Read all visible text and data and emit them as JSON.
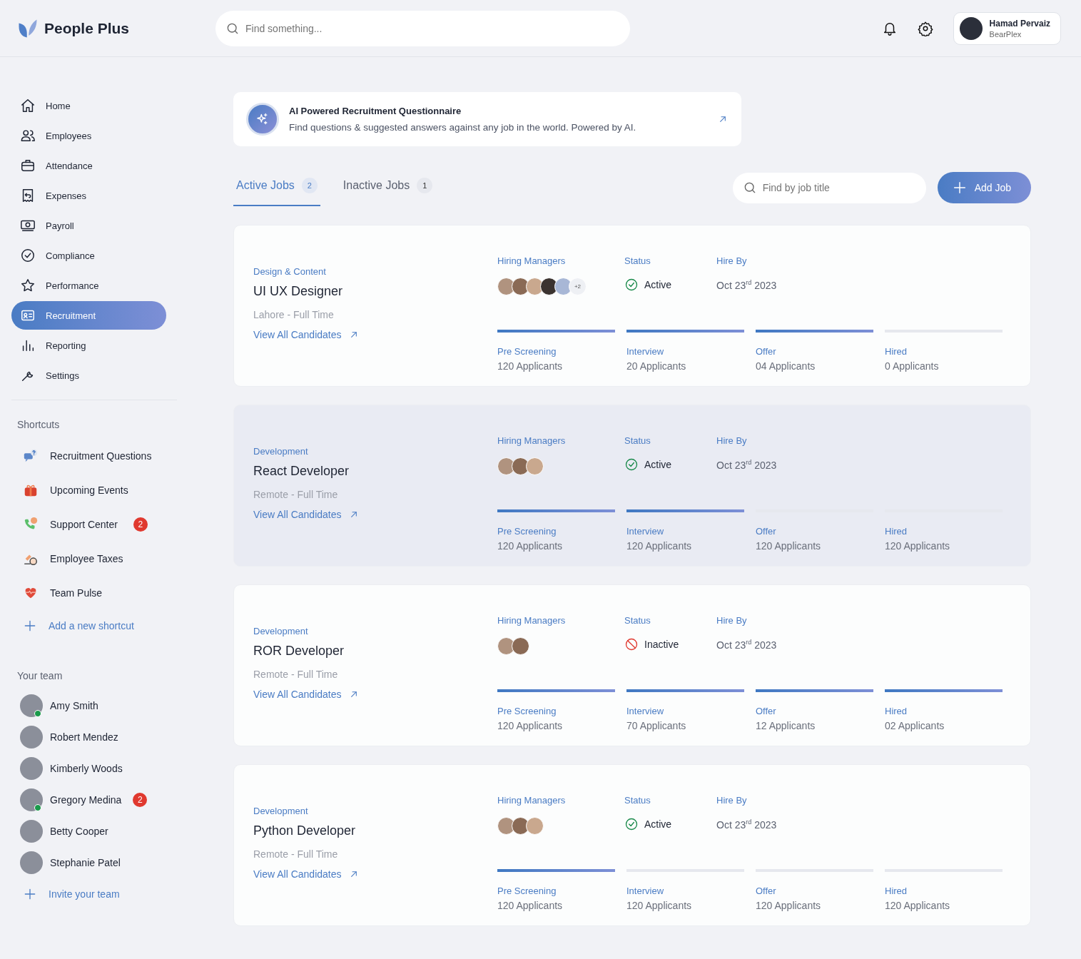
{
  "brand": {
    "name": "People Plus"
  },
  "search": {
    "placeholder": "Find something..."
  },
  "user": {
    "name": "Hamad Pervaiz",
    "company": "BearPlex"
  },
  "nav": [
    {
      "kind": "home",
      "label": "Home",
      "selected": false
    },
    {
      "kind": "employees",
      "label": "Employees",
      "selected": false
    },
    {
      "kind": "attendance",
      "label": "Attendance",
      "selected": false
    },
    {
      "kind": "expenses",
      "label": "Expenses",
      "selected": false
    },
    {
      "kind": "payroll",
      "label": "Payroll",
      "selected": false
    },
    {
      "kind": "compliance",
      "label": "Compliance",
      "selected": false
    },
    {
      "kind": "performance",
      "label": "Performance",
      "selected": false
    },
    {
      "kind": "recruitment",
      "label": "Recruitment",
      "selected": true
    },
    {
      "kind": "reporting",
      "label": "Reporting",
      "selected": false
    },
    {
      "kind": "settings",
      "label": "Settings",
      "selected": false
    }
  ],
  "shortcuts": {
    "title": "Shortcuts",
    "items": [
      {
        "kind": "chat",
        "label": "Recruitment Questions"
      },
      {
        "kind": "gift",
        "label": "Upcoming Events"
      },
      {
        "kind": "phone",
        "label": "Support Center",
        "badge": "2"
      },
      {
        "kind": "tax",
        "label": "Employee Taxes"
      },
      {
        "kind": "heart",
        "label": "Team Pulse"
      }
    ],
    "add": "Add a new shortcut"
  },
  "team": {
    "title": "Your team",
    "members": [
      {
        "name": "Amy Smith",
        "online": true
      },
      {
        "name": "Robert Mendez",
        "online": false
      },
      {
        "name": "Kimberly Woods",
        "online": false
      },
      {
        "name": "Gregory Medina",
        "online": true,
        "badge": "2"
      },
      {
        "name": "Betty Cooper",
        "online": false
      },
      {
        "name": "Stephanie Patel",
        "online": false
      }
    ],
    "invite": "Invite your team"
  },
  "banner": {
    "title": "AI Powered Recruitment Questionnaire",
    "text": "Find questions & suggested answers against any job in the world. Powered by AI."
  },
  "tabs": [
    {
      "label": "Active Jobs",
      "count": "2",
      "selected": true
    },
    {
      "label": "Inactive Jobs",
      "count": "1",
      "selected": false
    }
  ],
  "job_search": {
    "placeholder": "Find by job title"
  },
  "add_button": "Add Job",
  "jobs": [
    {
      "selected": false,
      "category": "Design & Content",
      "title": "UI UX Designer",
      "location": "Lahore - Full Time",
      "link": "View All Candidates",
      "managers_label": "Hiring Managers",
      "managers": [
        {
          "kind": "photo"
        },
        {
          "kind": "photo"
        },
        {
          "kind": "photo"
        },
        {
          "kind": "photo"
        },
        {
          "kind": "photo"
        }
      ],
      "more": "+2",
      "status_label": "Status",
      "status": {
        "kind": "active",
        "label": "Active"
      },
      "hire_label": "Hire By",
      "hire_by": "Oct 23$^{rd}$ 2023",
      "stages": [
        {
          "label": "Pre Screening",
          "count": "120 Applicants",
          "done": true
        },
        {
          "label": "Interview",
          "count": "20 Applicants",
          "done": true
        },
        {
          "label": "Offer",
          "count": "04 Applicants",
          "done": true
        },
        {
          "label": "Hired",
          "count": "0 Applicants",
          "done": false
        }
      ]
    },
    {
      "selected": true,
      "category": "Development",
      "title": "React Developer",
      "location": "Remote - Full Time",
      "link": "View All Candidates",
      "managers_label": "Hiring Managers",
      "managers": [
        {
          "kind": "photo"
        },
        {
          "kind": "photo"
        },
        {
          "kind": "photo"
        }
      ],
      "status_label": "Status",
      "status": {
        "kind": "active",
        "label": "Active"
      },
      "hire_label": "Hire By",
      "hire_by": "Oct 23$^{rd}$ 2023",
      "stages": [
        {
          "label": "Pre Screening",
          "count": "120 Applicants",
          "done": true
        },
        {
          "label": "Interview",
          "count": "120 Applicants",
          "done": true
        },
        {
          "label": "Offer",
          "count": "120 Applicants",
          "done": false
        },
        {
          "label": "Hired",
          "count": "120 Applicants",
          "done": false
        }
      ]
    },
    {
      "selected": false,
      "category": "Development",
      "title": "ROR Developer",
      "location": "Remote - Full Time",
      "link": "View All Candidates",
      "managers_label": "Hiring Managers",
      "managers": [
        {
          "kind": "photo"
        },
        {
          "kind": "photo"
        }
      ],
      "status_label": "Status",
      "status": {
        "kind": "inactive",
        "label": "Inactive"
      },
      "hire_label": "Hire By",
      "hire_by": "Oct 23$^{rd}$ 2023",
      "stages": [
        {
          "label": "Pre Screening",
          "count": "120 Applicants",
          "done": true
        },
        {
          "label": "Interview",
          "count": "70 Applicants",
          "done": true
        },
        {
          "label": "Offer",
          "count": "12 Applicants",
          "done": true
        },
        {
          "label": "Hired",
          "count": "02 Applicants",
          "done": true
        }
      ]
    },
    {
      "selected": false,
      "category": "Development",
      "title": "Python Developer",
      "location": "Remote - Full Time",
      "link": "View All Candidates",
      "managers_label": "Hiring Managers",
      "managers": [
        {
          "kind": "photo"
        },
        {
          "kind": "photo"
        },
        {
          "kind": "photo"
        }
      ],
      "status_label": "Status",
      "status": {
        "kind": "active",
        "label": "Active"
      },
      "hire_label": "Hire By",
      "hire_by": "Oct 23$^{rd}$ 2023",
      "stages": [
        {
          "label": "Pre Screening",
          "count": "120 Applicants",
          "done": true
        },
        {
          "label": "Interview",
          "count": "120 Applicants",
          "done": false
        },
        {
          "label": "Offer",
          "count": "120 Applicants",
          "done": false
        },
        {
          "label": "Hired",
          "count": "120 Applicants",
          "done": false
        }
      ]
    }
  ]
}
